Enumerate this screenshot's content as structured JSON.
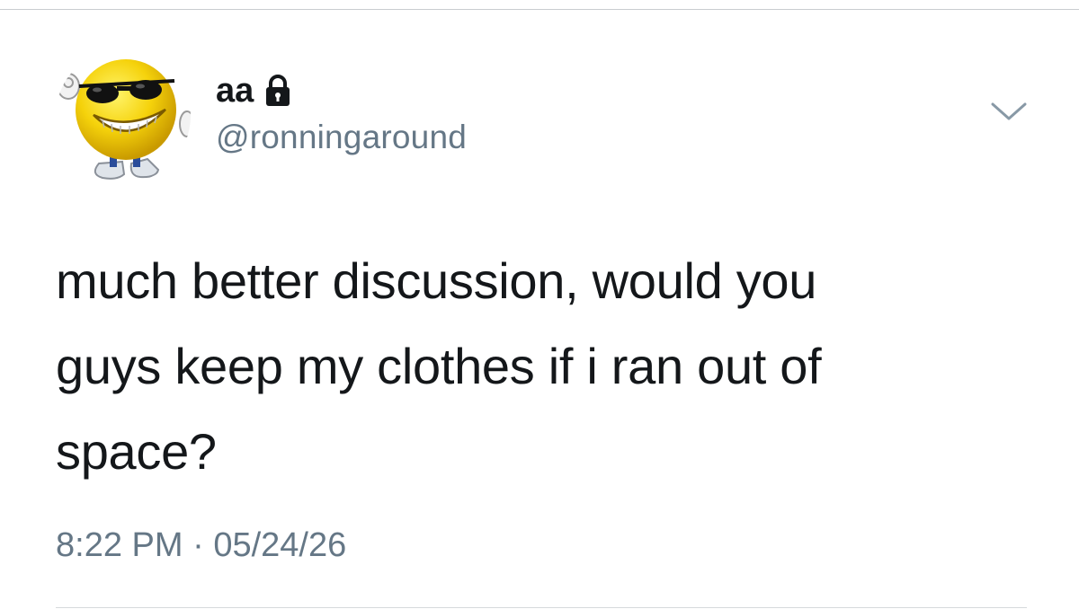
{
  "author": {
    "display_name": "aa",
    "handle": "@ronningaround",
    "protected_icon": "lock-icon",
    "avatar_icon": "sunglasses-smiley-avatar"
  },
  "menu_icon": "chevron-down-icon",
  "tweet": {
    "lines": [
      "much better discussion, would you",
      "guys keep my clothes if i ran out of",
      "space?"
    ],
    "time": "8:22 PM",
    "separator": "·",
    "date": "05/24/26"
  },
  "colors": {
    "text": "#14171a",
    "secondary": "#657786",
    "divider": "#d6d9dc"
  }
}
